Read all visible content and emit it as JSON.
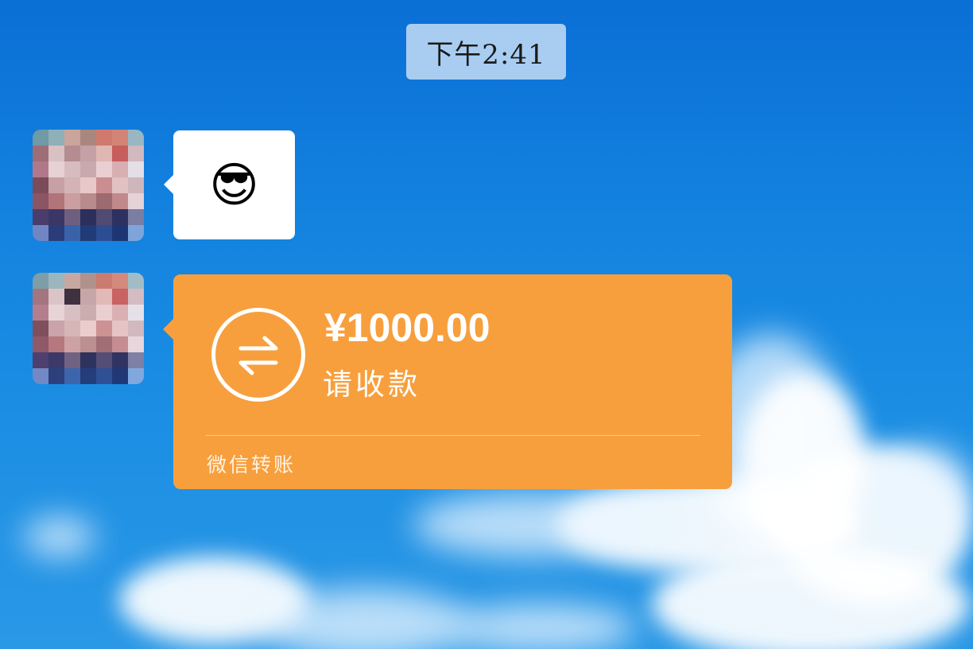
{
  "chat": {
    "timestamp": "下午2:41",
    "messages": [
      {
        "type": "emoji",
        "emoji": "😎",
        "emoji_icon": "sunglasses-face-icon"
      },
      {
        "type": "transfer",
        "amount": "¥1000.00",
        "status": "请收款",
        "footer": "微信转账",
        "icon": "transfer-arrows-icon"
      }
    ]
  },
  "colors": {
    "transfer_bubble": "#f79f3d",
    "emoji_bubble": "#ffffff",
    "timestamp_bg": "#a9cdf1",
    "sky": "#1483df"
  }
}
